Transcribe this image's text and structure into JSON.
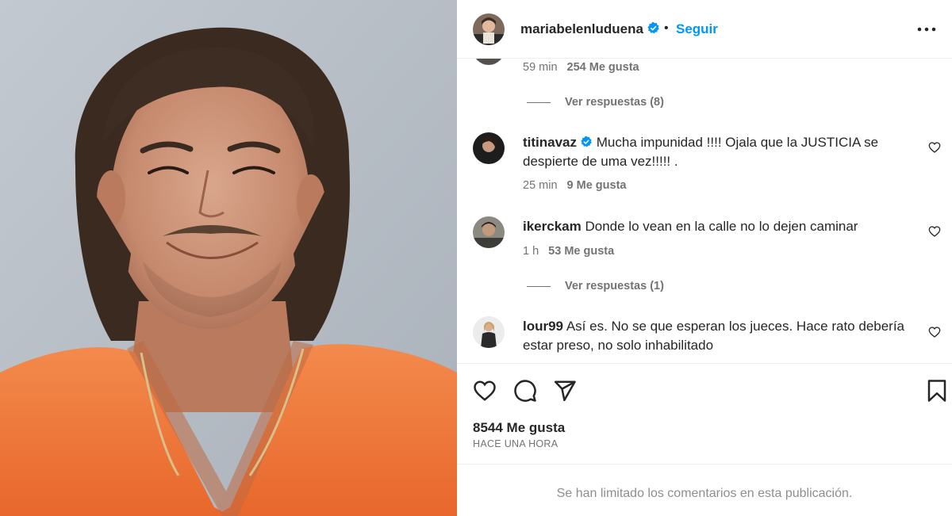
{
  "post": {
    "username": "mariabelenluduena",
    "verified": true,
    "separator": "•",
    "follow_label": "Seguir",
    "more_icon": "more-horizontal-icon",
    "likes_total": "8544 Me gusta",
    "time_label": "HACE UNA HORA",
    "comments_limited_notice": "Se han limitado los comentarios en esta publicación."
  },
  "comments": [
    {
      "id": "c0",
      "time": "59 min",
      "likes": "254 Me gusta",
      "replies_label": "Ver respuestas (8)"
    },
    {
      "id": "c1",
      "username": "titinavaz",
      "verified": true,
      "text": "Mucha impunidad !!!! Ojala que la JUSTICIA se despierte de uma vez!!!!! .",
      "time": "25 min",
      "likes": "9 Me gusta"
    },
    {
      "id": "c2",
      "username": "ikerckam",
      "verified": false,
      "text": "Donde lo vean en la calle no lo dejen caminar",
      "time": "1 h",
      "likes": "53 Me gusta",
      "replies_label": "Ver respuestas (1)"
    },
    {
      "id": "c3",
      "username": "lour99",
      "verified": false,
      "text": "Así es. No se que esperan los jueces. Hace rato debería estar preso, no solo inhabilitado"
    }
  ],
  "action_icons": [
    "heart-icon",
    "comment-icon",
    "share-icon",
    "bookmark-icon"
  ],
  "colors": {
    "accent": "#0095f6",
    "text": "#262626",
    "muted": "#737373",
    "shirt": "#f27a3c",
    "backdrop": "#b8bfc7"
  }
}
